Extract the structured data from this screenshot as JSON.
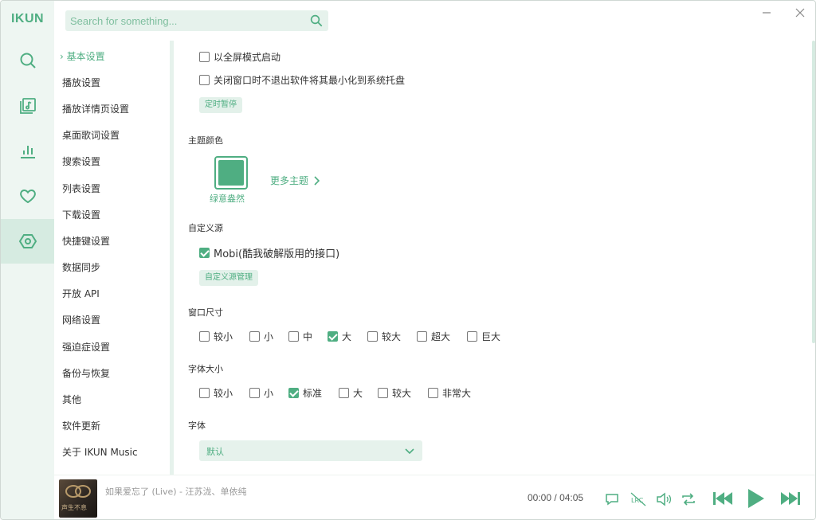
{
  "app": {
    "logo": "IKUN"
  },
  "search": {
    "placeholder": "Search for something..."
  },
  "rail": [
    "search-icon",
    "music-library-icon",
    "chart-icon",
    "heart-icon",
    "settings-icon"
  ],
  "nav": {
    "items": [
      "基本设置",
      "播放设置",
      "播放详情页设置",
      "桌面歌词设置",
      "搜索设置",
      "列表设置",
      "下载设置",
      "快捷键设置",
      "数据同步",
      "开放 API",
      "网络设置",
      "强迫症设置",
      "备份与恢复",
      "其他",
      "软件更新",
      "关于 IKUN Music"
    ],
    "active_marker": "›"
  },
  "basic": {
    "fullscreen_start": "以全屏模式启动",
    "minimize_to_tray": "关闭窗口时不退出软件将其最小化到系统托盘",
    "timer_pause": "定时暂停"
  },
  "theme": {
    "title": "主题颜色",
    "current_name": "绿意盎然",
    "current_color": "#4fae82",
    "more_label": "更多主题"
  },
  "custom_source": {
    "title": "自定义源",
    "source_name": "Mobi(酷我破解版用的接口)",
    "manage_label": "自定义源管理"
  },
  "window_size": {
    "title": "窗口尺寸",
    "options": [
      "较小",
      "小",
      "中",
      "大",
      "较大",
      "超大",
      "巨大"
    ],
    "selected": "大"
  },
  "font_size": {
    "title": "字体大小",
    "options": [
      "较小",
      "小",
      "标准",
      "大",
      "较大",
      "非常大"
    ],
    "selected": "标准"
  },
  "font": {
    "title": "字体",
    "value": "默认"
  },
  "player": {
    "cover_text": "声生不息",
    "song": "如果爱忘了 (Live) - 汪苏泷、单依纯",
    "current_time": "00:00",
    "separator": "/",
    "duration": "04:05",
    "lyric_label": "LRC"
  }
}
